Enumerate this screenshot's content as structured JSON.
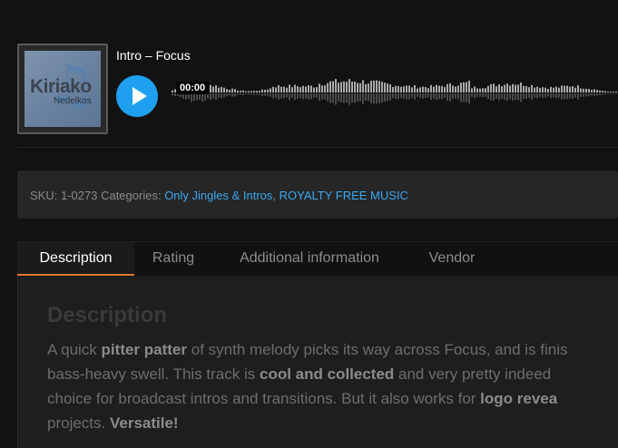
{
  "player": {
    "track_title": "Intro – Focus",
    "time": "00:00",
    "progress": 0,
    "cover": {
      "artist_line1": "Kiriako",
      "artist_line2": "Nedelkos"
    },
    "play_icon": "play-icon"
  },
  "meta": {
    "sku_label": "SKU:",
    "sku_value": "1-0273",
    "categories_label": "Categories:",
    "categories": [
      "Only Jingles & Intros",
      "ROYALTY FREE MUSIC"
    ],
    "separator": ", "
  },
  "tabs": [
    {
      "label": "Description",
      "active": true
    },
    {
      "label": "Rating",
      "active": false
    },
    {
      "label": "Additional information",
      "active": false
    },
    {
      "label": "Vendor",
      "active": false
    }
  ],
  "description": {
    "heading": "Description",
    "lines": [
      [
        {
          "t": "A quick "
        },
        {
          "t": "pitter patter",
          "b": true
        },
        {
          "t": " of synth melody picks its way across Focus, and is finis"
        }
      ],
      [
        {
          "t": "bass-heavy swell. This track is "
        },
        {
          "t": "cool and collected",
          "b": true
        },
        {
          "t": " and very pretty indeed"
        }
      ],
      [
        {
          "t": "choice for broadcast intros and transitions. But it also works for "
        },
        {
          "t": "logo revea",
          "b": true
        }
      ],
      [
        {
          "t": "projects. "
        },
        {
          "t": "Versatile!",
          "b": true
        }
      ]
    ]
  },
  "colors": {
    "accent": "#1e9ff0",
    "link": "#3ba7f0",
    "tab_underline": "#e2762f",
    "background": "#121212"
  }
}
